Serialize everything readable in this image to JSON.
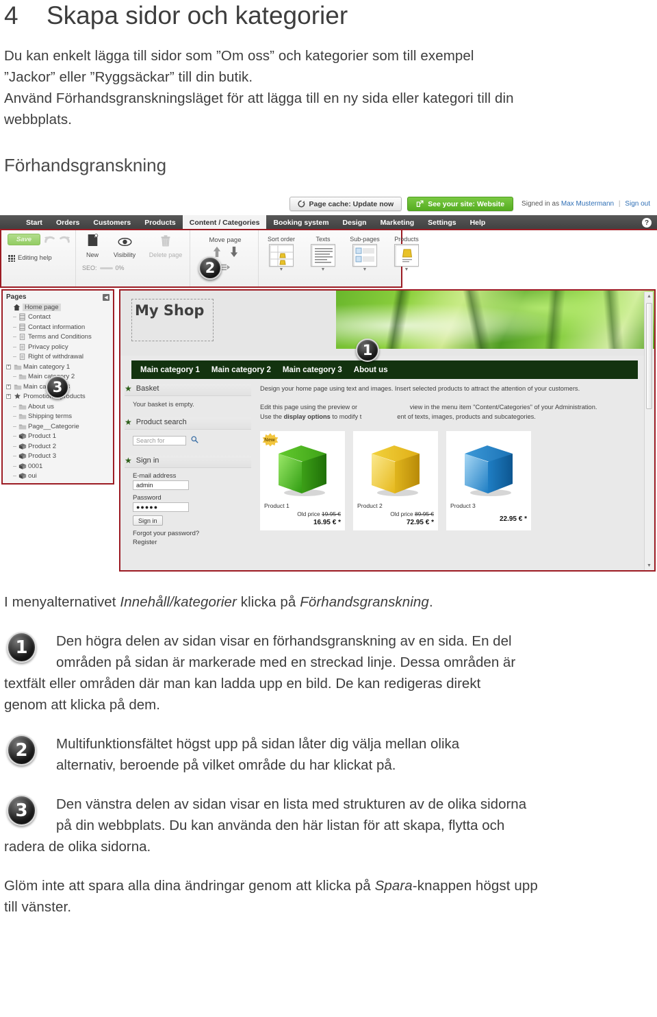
{
  "document": {
    "chapter_number": "4",
    "chapter_title": "Skapa sidor och kategorier",
    "intro_line1": "Du kan enkelt lägga till sidor som ”Om oss” och kategorier som till exempel",
    "intro_line2": "”Jackor” eller ”Ryggsäckar” till din butik.",
    "intro_line3": "Använd Förhandsgranskningsläget för att lägga till en ny sida eller kategori till din",
    "intro_line4": "webbplats.",
    "section_heading": "Förhandsgranskning",
    "caption_before": "I menyalternativet ",
    "caption_italic1": "Innehåll/kategorier",
    "caption_middle": " klicka på ",
    "caption_italic2": "Förhandsgranskning",
    "caption_end": ".",
    "items": [
      {
        "number": "1",
        "line1": "Den högra delen av sidan visar en förhandsgranskning av en sida. En del",
        "line2": "områden på sidan är markerade med en streckad linje. Dessa områden är",
        "line3": "textfält eller områden där man kan ladda upp en bild. De kan redigeras direkt",
        "line4": "genom att klicka på dem."
      },
      {
        "number": "2",
        "line1": "Multifunktionsfältet högst upp på sidan låter dig välja mellan olika",
        "line2": "alternativ, beroende på vilket område du har klickat på.",
        "line3": "",
        "line4": ""
      },
      {
        "number": "3",
        "line1": "Den vänstra delen av sidan visar en lista med strukturen av de olika sidorna",
        "line2": "på din webbplats. Du kan använda den här listan för att skapa, flytta och",
        "line3": "radera de olika sidorna.",
        "line4": ""
      }
    ],
    "closing_before": "Glöm inte att spara alla dina ändringar genom att klicka på ",
    "closing_italic": "Spara",
    "closing_after": "-knappen högst upp",
    "closing_line2": "till vänster."
  },
  "screenshot": {
    "utility_bar": {
      "page_cache_label": "Page cache: Update now",
      "see_site_label": "See your site: Website",
      "signed_in_prefix": "Signed in as",
      "user_name": "Max Mustermann",
      "separator": "|",
      "sign_out_label": "Sign out"
    },
    "main_nav": {
      "items": [
        {
          "label": "Start",
          "active": false
        },
        {
          "label": "Orders",
          "active": false
        },
        {
          "label": "Customers",
          "active": false
        },
        {
          "label": "Products",
          "active": false
        },
        {
          "label": "Content / Categories",
          "active": true
        },
        {
          "label": "Booking system",
          "active": false
        },
        {
          "label": "Design",
          "active": false
        },
        {
          "label": "Marketing",
          "active": false
        },
        {
          "label": "Settings",
          "active": false
        },
        {
          "label": "Help",
          "active": false
        }
      ],
      "help_icon": "?"
    },
    "ribbon": {
      "save_label": "Save",
      "editing_help_label": "Editing help",
      "new_label": "New",
      "visibility_label": "Visibility",
      "delete_page_label": "Delete page",
      "seo_label": "SEO:",
      "seo_value": "0%",
      "move_page_label": "Move page",
      "gallery": [
        {
          "label": "Sort order"
        },
        {
          "label": "Texts"
        },
        {
          "label": "Sub-pages"
        },
        {
          "label": "Products"
        }
      ],
      "badge": "2"
    },
    "pages_panel": {
      "title": "Pages",
      "badge": "3",
      "nodes": [
        {
          "label": "Home page",
          "icon": "home-icon",
          "depth": 0,
          "expander": "",
          "selected": true
        },
        {
          "label": "Contact",
          "icon": "page-icon",
          "depth": 1,
          "expander": "",
          "selected": false
        },
        {
          "label": "Contact information",
          "icon": "page-icon",
          "depth": 1,
          "expander": "",
          "selected": false
        },
        {
          "label": "Terms and Conditions",
          "icon": "doc-icon",
          "depth": 1,
          "expander": "",
          "selected": false
        },
        {
          "label": "Privacy policy",
          "icon": "doc-icon",
          "depth": 1,
          "expander": "",
          "selected": false
        },
        {
          "label": "Right of withdrawal",
          "icon": "doc-icon",
          "depth": 1,
          "expander": "",
          "selected": false
        },
        {
          "label": "Main category 1",
          "icon": "folder-icon",
          "depth": 0,
          "expander": "+",
          "selected": false
        },
        {
          "label": "Main category 2",
          "icon": "folder-icon",
          "depth": 1,
          "expander": "",
          "selected": false
        },
        {
          "label": "Main category 3",
          "icon": "folder-icon",
          "depth": 0,
          "expander": "+",
          "selected": false
        },
        {
          "label": "Promotional products",
          "icon": "star-icon",
          "depth": 0,
          "expander": "+",
          "selected": false
        },
        {
          "label": "About us",
          "icon": "folder-icon",
          "depth": 1,
          "expander": "",
          "selected": false
        },
        {
          "label": "Shipping terms",
          "icon": "folder-icon",
          "depth": 1,
          "expander": "",
          "selected": false
        },
        {
          "label": "Page__Categorie",
          "icon": "folder-icon",
          "depth": 1,
          "expander": "",
          "selected": false
        },
        {
          "label": "Product 1",
          "icon": "box-icon",
          "depth": 1,
          "expander": "",
          "selected": false
        },
        {
          "label": "Product 2",
          "icon": "box-icon",
          "depth": 1,
          "expander": "",
          "selected": false
        },
        {
          "label": "Product 3",
          "icon": "box-icon",
          "depth": 1,
          "expander": "",
          "selected": false
        },
        {
          "label": "0001",
          "icon": "box-icon",
          "depth": 1,
          "expander": "",
          "selected": false
        },
        {
          "label": "oui",
          "icon": "box-icon",
          "depth": 1,
          "expander": "",
          "selected": false
        }
      ]
    },
    "preview": {
      "shop_title": "My Shop",
      "badge": "1",
      "category_nav": [
        "Main category 1",
        "Main category 2",
        "Main category 3",
        "About us"
      ],
      "widgets": {
        "basket_title": "Basket",
        "basket_text": "Your basket is empty.",
        "search_title": "Product search",
        "search_placeholder": "Search for",
        "signin_title": "Sign in",
        "email_label": "E-mail address",
        "email_value": "admin",
        "password_label": "Password",
        "password_value": "●●●●●",
        "signin_button": "Sign in",
        "forgot_link": "Forgot your password?",
        "register_link": "Register"
      },
      "main_text": {
        "p1": "Design your home page using text and images. Insert selected products to attract the attention of your customers.",
        "p2a": "Edit this page using the preview or ",
        "p2b": "view in the menu item \"Content/Categories\" of your Administration.",
        "p3a": "Use the ",
        "p3b": "display options",
        "p3c": " to modify t",
        "p3d": "ent of texts, images, products and subcategories."
      },
      "products": [
        {
          "name": "Product 1",
          "new_flag": "New",
          "old_price_label": "Old price",
          "old_price": "19.95 €",
          "price": "16.95 € *",
          "color": "#4ec11e"
        },
        {
          "name": "Product 2",
          "new_flag": "",
          "old_price_label": "Old price",
          "old_price": "89.95 €",
          "price": "72.95 € *",
          "color": "#f0cf2a"
        },
        {
          "name": "Product 3",
          "new_flag": "",
          "old_price_label": "",
          "old_price": "",
          "price": "22.95 € *",
          "color": "#2f93de"
        }
      ]
    }
  },
  "colors": {
    "accent_red": "#9c1b23",
    "green_button": "#55ad21",
    "nav_dark": "#3f3f3f",
    "category_bar": "#13330f"
  }
}
